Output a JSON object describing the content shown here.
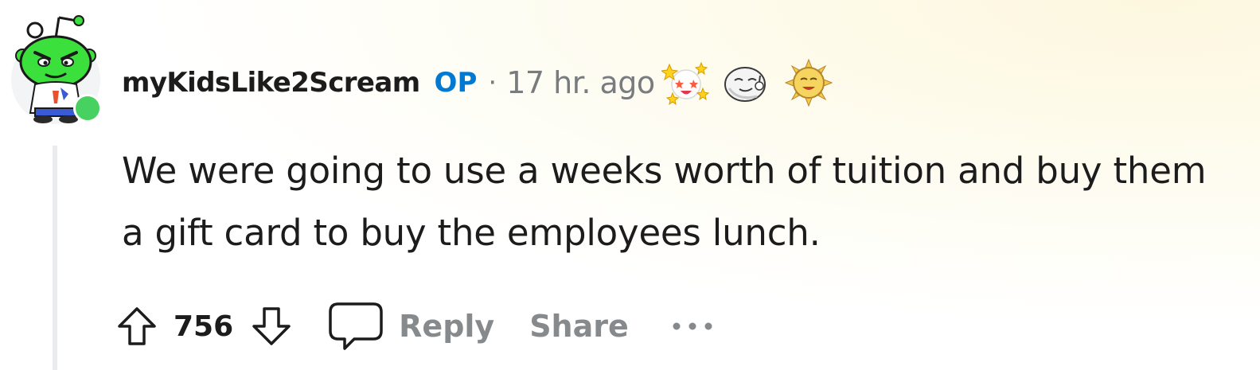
{
  "comment": {
    "avatar_icon": "snoo-avatar-icon",
    "online_status_color": "#46d160",
    "username": "myKidsLike2Scream",
    "op_badge": "OP",
    "separator": "·",
    "timestamp": "17 hr. ago",
    "awards": [
      "starstruck-award-icon",
      "moon-face-award-icon",
      "sun-face-award-icon"
    ],
    "body": "We were going to use a weeks worth of tuition and buy them a gift card to buy the employees lunch.",
    "score": "756",
    "actions": {
      "reply_label": "Reply",
      "share_label": "Share",
      "more_icon": "ellipsis-icon"
    }
  },
  "colors": {
    "op_badge": "#0079d3",
    "meta_text": "#787c7e",
    "action_text": "#878a8c",
    "primary_text": "#1c1c1c"
  }
}
